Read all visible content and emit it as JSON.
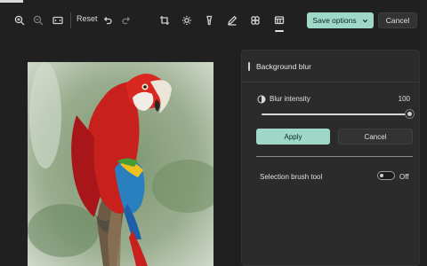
{
  "toolbar": {
    "reset_label": "Reset",
    "save_label": "Save options",
    "cancel_label": "Cancel",
    "icons": [
      "zoom-in-icon",
      "zoom-out-icon",
      "fit-view-icon",
      "undo-icon",
      "redo-icon",
      "crop-icon",
      "brightness-icon",
      "marker-icon",
      "draw-icon",
      "filter-icon",
      "background-icon"
    ]
  },
  "panel": {
    "title": "Background blur",
    "blur_intensity_label": "Blur intensity",
    "blur_intensity_value": "100",
    "blur_intensity_fraction": 1.0,
    "apply_label": "Apply",
    "cancel_label": "Cancel",
    "brush_tool_label": "Selection brush tool",
    "brush_tool_state": "Off"
  },
  "colors": {
    "accent": "#9fd8c8",
    "background": "#202020",
    "panel": "#2b2b2b"
  }
}
